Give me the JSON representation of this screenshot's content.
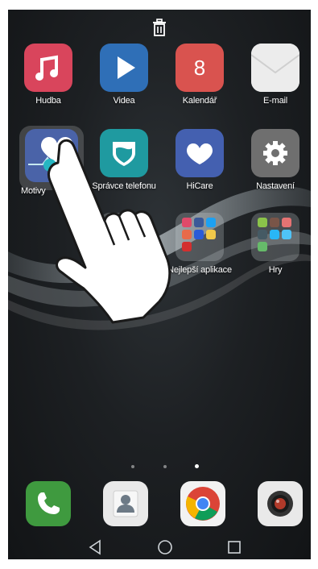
{
  "home_screen": {
    "apps": [
      {
        "label": "Hudba",
        "icon": "music-note-icon",
        "color": "#d9455c"
      },
      {
        "label": "Videa",
        "icon": "play-icon",
        "color": "#2f6fb7"
      },
      {
        "label": "Kalendář",
        "icon": "calendar-icon",
        "color": "#d9534f",
        "badge": "8"
      },
      {
        "label": "E-mail",
        "icon": "envelope-icon",
        "color": "#e8e8e8"
      },
      {
        "label": "Motivy",
        "icon": "heart-pulse-icon",
        "color": "#4a63a8"
      },
      {
        "label": "Správce telefonu",
        "icon": "shield-icon",
        "color": "#1f9aa0"
      },
      {
        "label": "HiCare",
        "icon": "heart-icon",
        "color": "#4460b0"
      },
      {
        "label": "Nastavení",
        "icon": "gear-icon",
        "color": "#6f6f6f"
      }
    ],
    "folders": [
      {
        "label": "Nejlepší aplikace",
        "icon": "app-folder-icon"
      },
      {
        "label": "Hry",
        "icon": "games-folder-icon"
      }
    ],
    "page_indicator": {
      "count": 3,
      "active_index": 2
    }
  },
  "dock": [
    {
      "name": "phone",
      "icon": "phone-icon",
      "color": "#3f9a3f"
    },
    {
      "name": "contacts",
      "icon": "contacts-icon",
      "color": "#e9e9e9"
    },
    {
      "name": "chrome",
      "icon": "chrome-icon",
      "color": "#f2f2f2"
    },
    {
      "name": "camera",
      "icon": "camera-icon",
      "color": "#e9e9e9"
    }
  ],
  "navigation": {
    "back": "back-triangle-icon",
    "home": "home-circle-icon",
    "recent": "recent-square-icon"
  },
  "trash": {
    "icon": "trash-icon"
  }
}
